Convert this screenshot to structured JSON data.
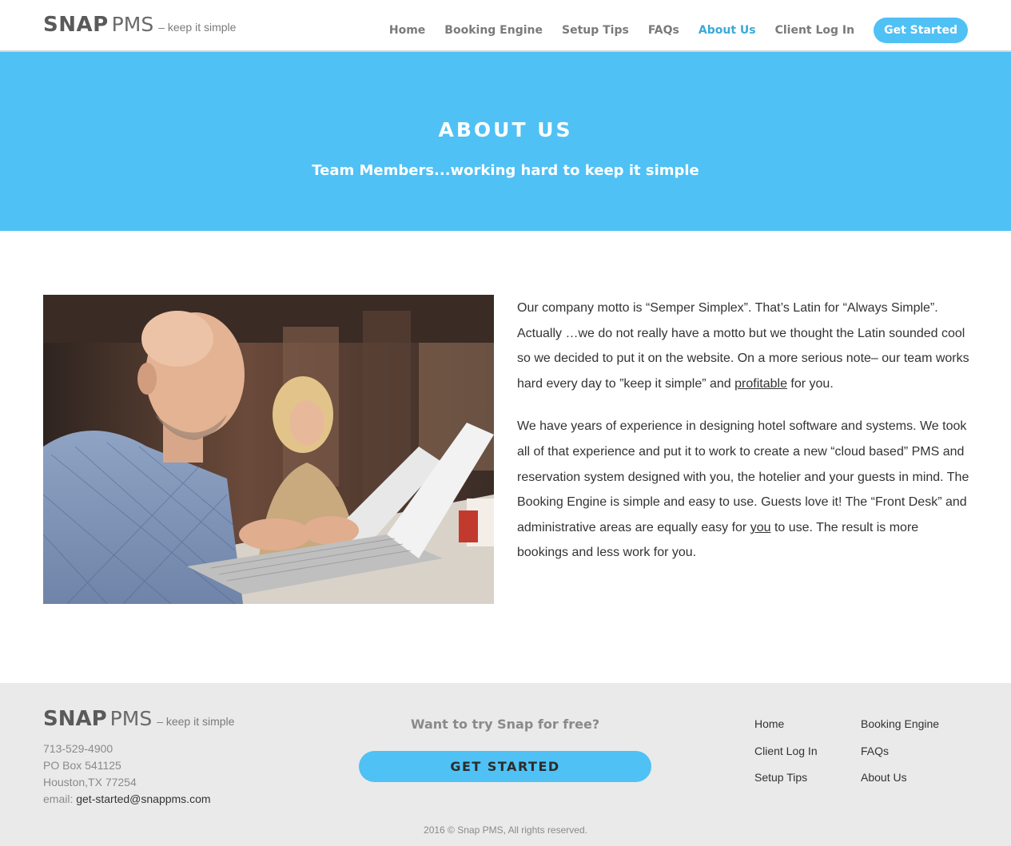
{
  "header": {
    "brand_bold": "SNAP",
    "brand_light": "PMS",
    "tagline": "– keep it simple",
    "nav": [
      {
        "label": "Home"
      },
      {
        "label": "Booking Engine"
      },
      {
        "label": "Setup Tips"
      },
      {
        "label": "FAQs"
      },
      {
        "label": "About Us",
        "active": true
      },
      {
        "label": "Client Log In"
      }
    ],
    "cta_label": "Get Started"
  },
  "hero": {
    "title": "ABOUT US",
    "subtitle": "Team Members...working hard to keep it simple"
  },
  "main": {
    "paragraph1_a": "Our company motto is “Semper Simplex”. That’s Latin for “Always Simple”. Actually …we do not really have a motto but we thought the Latin sounded cool so we decided to put it on the website. On a more serious note– our team works hard every day to ”keep it simple” and ",
    "paragraph1_link": "profitable",
    "paragraph1_b": " for you.",
    "paragraph2_a": "We have years of experience in designing hotel software and systems. We took all of that experience and put it to work to create a new “cloud based” PMS and reservation system designed with you, the hotelier and your guests in mind.  The Booking Engine is simple and easy to use. Guests love it! The “Front Desk” and administrative areas are equally easy for ",
    "paragraph2_u": "you",
    "paragraph2_b": " to use. The result is more bookings and less work for you."
  },
  "footer": {
    "brand_bold": "SNAP",
    "brand_light": "PMS",
    "tagline": "– keep it simple",
    "phone": "713-529-4900",
    "po_box": "PO Box 541125",
    "city": "Houston,TX 77254",
    "email_label": "email: ",
    "email": "get-started@snappms.com",
    "cta_text": "Want to try Snap for free?",
    "cta_button": "GET STARTED",
    "links": [
      "Home",
      "Booking Engine",
      "Client Log In",
      "FAQs",
      "Setup Tips",
      "About Us"
    ],
    "copyright": "2016 © Snap PMS, All rights reserved."
  },
  "colors": {
    "accent": "#4fc1f5",
    "nav_active": "#3aa9d9",
    "footer_bg": "#eaeaea"
  }
}
